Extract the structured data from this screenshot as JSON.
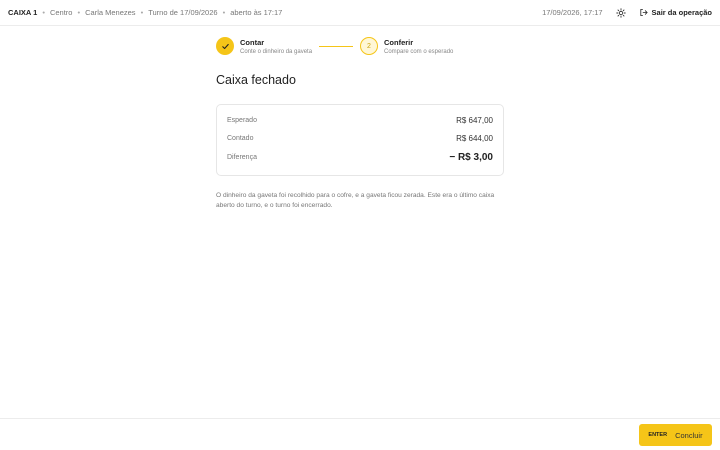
{
  "topbar": {
    "caixa": "CAIXA 1",
    "loja": "Centro",
    "operador": "Carla Menezes",
    "turno": "Turno de 17/09/2026",
    "abertura": "aberto às 17:17",
    "datetime": "17/09/2026, 17:17",
    "theme_icon": "sun-icon",
    "exit_label": "Sair da operação",
    "exit_icon": "logout-icon"
  },
  "stepper": {
    "steps": [
      {
        "number": "1",
        "title": "Contar",
        "subtitle": "Conte o dinheiro da gaveta",
        "status": "done"
      },
      {
        "number": "2",
        "title": "Conferir",
        "subtitle": "Compare com o esperado",
        "status": "current"
      }
    ]
  },
  "main": {
    "title": "Caixa fechado",
    "summary": [
      {
        "label": "Esperado",
        "value": "R$ 647,00"
      },
      {
        "label": "Contado",
        "value": "R$ 644,00"
      },
      {
        "label": "Diferença",
        "value": "− R$ 3,00"
      }
    ],
    "description": "O dinheiro da gaveta foi recolhido para o cofre, e a gaveta ficou zerada. Este era o último caixa aberto do turno, e o turno foi encerrado."
  },
  "footer": {
    "key_hint": "ENTER",
    "button_label": "Concluir"
  },
  "colors": {
    "accent": "#f5c518",
    "accent_light": "#fff7d6"
  }
}
